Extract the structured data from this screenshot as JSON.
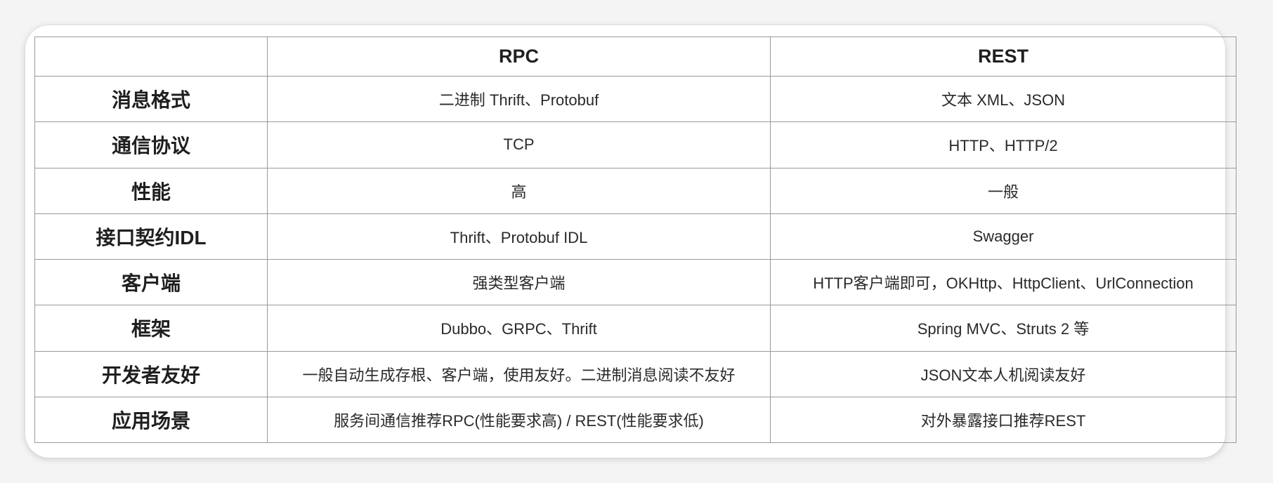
{
  "table": {
    "headers": [
      "",
      "RPC",
      "REST"
    ],
    "rows": [
      {
        "label": "消息格式",
        "rpc": "二进制 Thrift、Protobuf",
        "rest": "文本 XML、JSON"
      },
      {
        "label": "通信协议",
        "rpc": "TCP",
        "rest": "HTTP、HTTP/2"
      },
      {
        "label": "性能",
        "rpc": "高",
        "rest": "一般"
      },
      {
        "label": "接口契约IDL",
        "rpc": "Thrift、Protobuf IDL",
        "rest": "Swagger"
      },
      {
        "label": "客户端",
        "rpc": "强类型客户端",
        "rest": "HTTP客户端即可，OKHttp、HttpClient、UrlConnection"
      },
      {
        "label": "框架",
        "rpc": "Dubbo、GRPC、Thrift",
        "rest": "Spring MVC、Struts 2 等"
      },
      {
        "label": "开发者友好",
        "rpc": "一般自动生成存根、客户端，使用友好。二进制消息阅读不友好",
        "rest": "JSON文本人机阅读友好"
      },
      {
        "label": "应用场景",
        "rpc": "服务间通信推荐RPC(性能要求高) / REST(性能要求低)",
        "rest": "对外暴露接口推荐REST"
      }
    ]
  }
}
